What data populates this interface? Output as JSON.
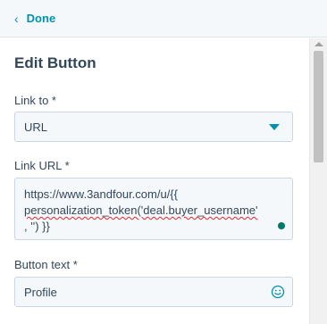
{
  "topbar": {
    "done_label": "Done",
    "back_icon": "chevron-left-icon"
  },
  "panel": {
    "title": "Edit Button",
    "link_to": {
      "label": "Link to *",
      "selected": "URL",
      "icon": "caret-down-icon"
    },
    "link_url": {
      "label": "Link URL *",
      "line1": "https://www.3andfour.com/u/{{",
      "line2": "personalization_token('deal.buyer_username'",
      "line3": ", '') }}"
    },
    "button_text": {
      "label": "Button text *",
      "value": "Profile",
      "icon": "emoji-smile-icon"
    }
  },
  "colors": {
    "accent": "#0091ae",
    "text": "#33475b",
    "field_bg": "#f5f8fa",
    "border": "#cbd6e2",
    "spell_error": "#e0262c"
  }
}
